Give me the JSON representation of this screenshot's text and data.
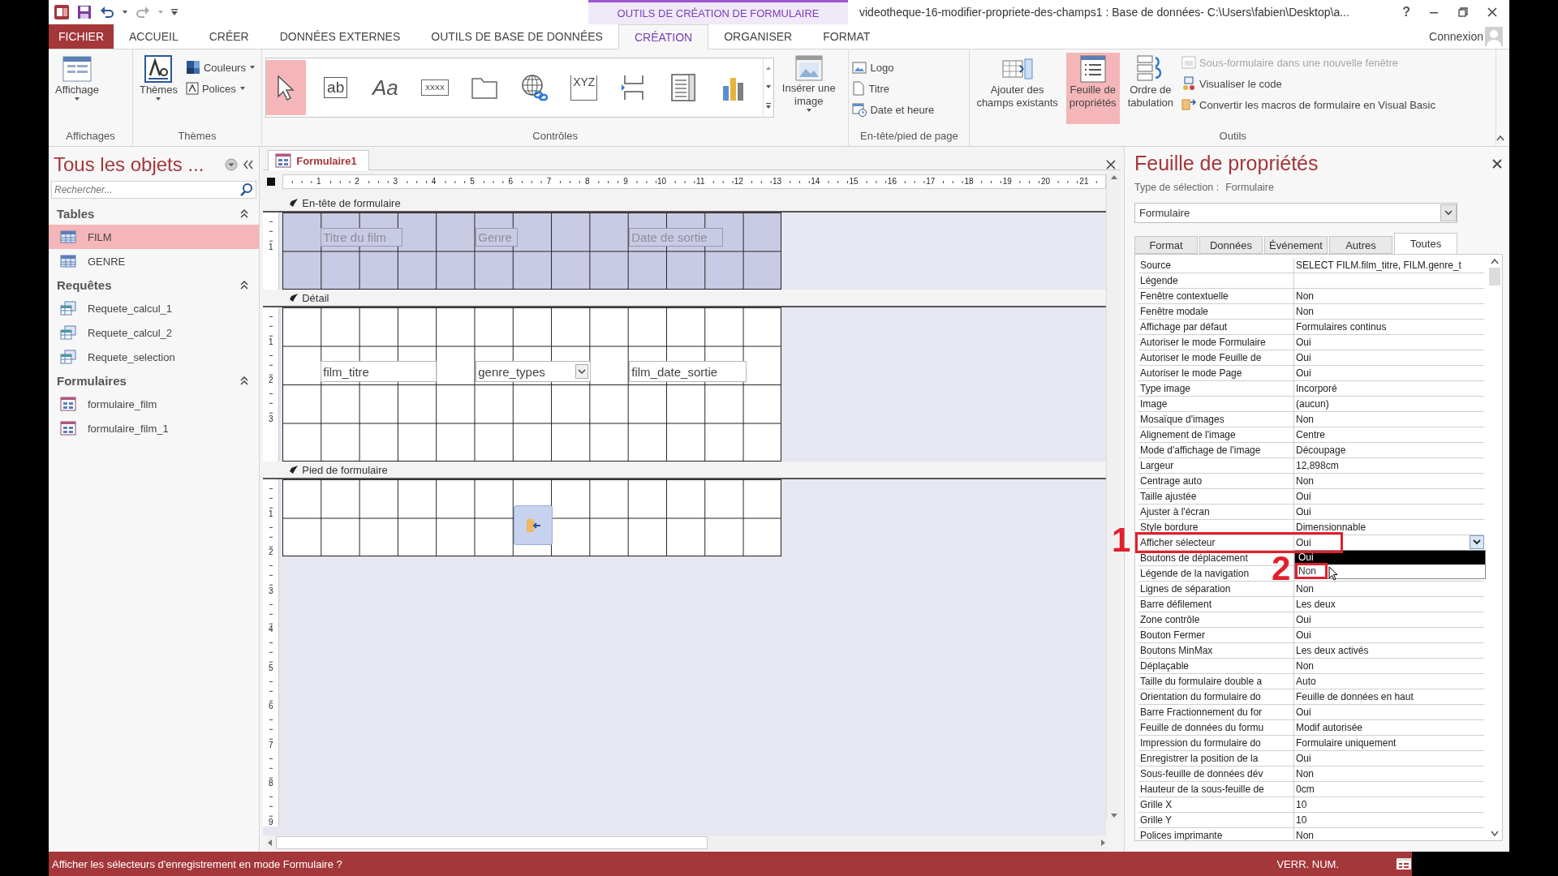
{
  "window": {
    "title": "videotheque-16-modifier-propriete-des-champs1 : Base de données- C:\\Users\\fabien\\Desktop\\a...",
    "contextual_group": "OUTILS DE CRÉATION DE FORMULAIRE",
    "help": "?"
  },
  "ribbon_tabs": [
    {
      "label": "FICHIER",
      "kind": "file",
      "selected": false
    },
    {
      "label": "ACCUEIL",
      "kind": "tab",
      "selected": false
    },
    {
      "label": "CRÉER",
      "kind": "tab",
      "selected": false
    },
    {
      "label": "DONNÉES EXTERNES",
      "kind": "tab",
      "selected": false
    },
    {
      "label": "OUTILS DE BASE DE DONNÉES",
      "kind": "tab",
      "selected": false
    },
    {
      "label": "CRÉATION",
      "kind": "contextual",
      "selected": true
    },
    {
      "label": "ORGANISER",
      "kind": "contextual",
      "selected": false
    },
    {
      "label": "FORMAT",
      "kind": "contextual",
      "selected": false
    }
  ],
  "account": {
    "label": "Connexion"
  },
  "ribbon": {
    "views": {
      "label": "Affichages",
      "button": "Affichage"
    },
    "themes": {
      "label": "Thèmes",
      "button": "Thèmes",
      "colors": "Couleurs",
      "fonts": "Polices"
    },
    "controls": {
      "label": "Contrôles",
      "gallery": [
        {
          "kind": "pointer",
          "selected": true
        },
        {
          "kind": "textbox",
          "glyph": "ab",
          "selected": false
        },
        {
          "kind": "label",
          "glyph": "Aa",
          "selected": false
        },
        {
          "kind": "button",
          "glyph": "XXXX",
          "selected": false
        },
        {
          "kind": "tab",
          "selected": false
        },
        {
          "kind": "hyperlink",
          "selected": false
        },
        {
          "kind": "frame",
          "glyph": "XYZ",
          "selected": false
        },
        {
          "kind": "pagebreak",
          "selected": false
        },
        {
          "kind": "listbox",
          "selected": false
        },
        {
          "kind": "chart",
          "selected": false
        }
      ],
      "insert_image": "Insérer une\nimage"
    },
    "header_footer": {
      "label": "En-tête/pied de page",
      "items": [
        {
          "kind": "logo",
          "label": "Logo"
        },
        {
          "kind": "title",
          "label": "Titre"
        },
        {
          "kind": "datetime",
          "label": "Date et heure"
        }
      ]
    },
    "tools": {
      "label": "Outils",
      "large": [
        {
          "kind": "fields",
          "label": "Ajouter des\nchamps existants",
          "selected": false
        },
        {
          "kind": "sheet",
          "label": "Feuille de\npropriétés",
          "selected": true
        },
        {
          "kind": "taborder",
          "label": "Ordre de\ntabulation",
          "selected": false
        }
      ],
      "small": [
        {
          "kind": "subform",
          "label": "Sous-formulaire dans une nouvelle fenêtre",
          "disabled": true
        },
        {
          "kind": "code",
          "label": "Visualiser le code",
          "disabled": false
        },
        {
          "kind": "convert",
          "label": "Convertir les macros de formulaire en Visual Basic",
          "disabled": false
        }
      ]
    }
  },
  "nav_pane": {
    "title": "Tous les objets ...",
    "search": {
      "placeholder": "Rechercher..."
    },
    "groups": [
      {
        "label": "Tables",
        "expanded": true,
        "items": [
          {
            "label": "FILM",
            "kind": "table",
            "selected": true
          },
          {
            "label": "GENRE",
            "kind": "table",
            "selected": false
          }
        ]
      },
      {
        "label": "Requêtes",
        "expanded": true,
        "items": [
          {
            "label": "Requete_calcul_1",
            "kind": "query",
            "selected": false
          },
          {
            "label": "Requete_calcul_2",
            "kind": "query",
            "selected": false
          },
          {
            "label": "Requete_selection",
            "kind": "query",
            "selected": false
          }
        ]
      },
      {
        "label": "Formulaires",
        "expanded": true,
        "items": [
          {
            "label": "formulaire_film",
            "kind": "form",
            "selected": false
          },
          {
            "label": "formulaire_film_1",
            "kind": "form",
            "selected": false
          }
        ]
      }
    ]
  },
  "document": {
    "tab": "Formulaire1",
    "ruler": [
      "1",
      "2",
      "3",
      "4",
      "5",
      "6",
      "7",
      "8",
      "9",
      "10",
      "11",
      "12",
      "13",
      "14",
      "15",
      "16",
      "17",
      "18",
      "19",
      "20",
      "21"
    ],
    "sections": [
      {
        "title": "En-tête de formulaire",
        "kind": "header",
        "vruler": [
          "1"
        ],
        "controls": [
          {
            "kind": "label",
            "text": "Titre du film"
          },
          {
            "kind": "label",
            "text": "Genre"
          },
          {
            "kind": "label",
            "text": "Date de sortie"
          }
        ]
      },
      {
        "title": "Détail",
        "kind": "detail",
        "vruler": [
          "1",
          "2",
          "3"
        ],
        "controls": [
          {
            "kind": "textbox",
            "text": "film_titre"
          },
          {
            "kind": "combobox",
            "text": "genre_types"
          },
          {
            "kind": "textbox",
            "text": "film_date_sortie"
          }
        ]
      },
      {
        "title": "Pied de formulaire",
        "kind": "footer",
        "vruler": [
          "1",
          "2",
          "3",
          "4",
          "5",
          "6",
          "7",
          "8",
          "9"
        ],
        "controls": [
          {
            "kind": "button"
          }
        ]
      }
    ]
  },
  "property_sheet": {
    "title": "Feuille de propriétés",
    "selection_label": "Type de sélection :",
    "selection_type": "Formulaire",
    "object": "Formulaire",
    "tabs": [
      {
        "label": "Format",
        "selected": false
      },
      {
        "label": "Données",
        "selected": false
      },
      {
        "label": "Événement",
        "selected": false
      },
      {
        "label": "Autres",
        "selected": false
      },
      {
        "label": "Toutes",
        "selected": true
      }
    ],
    "properties": [
      {
        "name": "Source",
        "value": "SELECT FILM.film_titre, FILM.genre_t"
      },
      {
        "name": "Légende"
      },
      {
        "name": "Fenêtre contextuelle",
        "value": "Non"
      },
      {
        "name": "Fenêtre modale",
        "value": "Non"
      },
      {
        "name": "Affichage par défaut",
        "value": "Formulaires continus"
      },
      {
        "name": "Autoriser le mode Formulaire",
        "value": "Oui"
      },
      {
        "name": "Autoriser le mode Feuille de",
        "value": "Oui"
      },
      {
        "name": "Autoriser le mode Page",
        "value": "Oui"
      },
      {
        "name": "Type image",
        "value": "Incorporé"
      },
      {
        "name": "Image",
        "value": "(aucun)"
      },
      {
        "name": "Mosaïque d'images",
        "value": "Non"
      },
      {
        "name": "Alignement de l'image",
        "value": "Centre"
      },
      {
        "name": "Mode d'affichage de l'image",
        "value": "Découpage"
      },
      {
        "name": "Largeur",
        "value": "12,898cm"
      },
      {
        "name": "Centrage auto",
        "value": "Non"
      },
      {
        "name": "Taille ajustée",
        "value": "Oui"
      },
      {
        "name": "Ajuster à l'écran",
        "value": "Oui"
      },
      {
        "name": "Style bordure",
        "value": "Dimensionnable"
      },
      {
        "name": "Afficher sélecteur",
        "value": "Oui",
        "dropdown": [
          {
            "label": "Oui",
            "selected": true
          },
          {
            "label": "Non",
            "selected": false
          }
        ]
      },
      {
        "name": "Boutons de déplacement"
      },
      {
        "name": "Légende de la navigation"
      },
      {
        "name": "Lignes de séparation",
        "value": "Non"
      },
      {
        "name": "Barre défilement",
        "value": "Les deux"
      },
      {
        "name": "Zone contrôle",
        "value": "Oui"
      },
      {
        "name": "Bouton Fermer",
        "value": "Oui"
      },
      {
        "name": "Boutons MinMax",
        "value": "Les deux activés"
      },
      {
        "name": "Déplaçable",
        "value": "Non"
      },
      {
        "name": "Taille du formulaire double a",
        "value": "Auto"
      },
      {
        "name": "Orientation du formulaire do",
        "value": "Feuille de données en haut"
      },
      {
        "name": "Barre Fractionnement du for",
        "value": "Oui"
      },
      {
        "name": "Feuille de données du formu",
        "value": "Modif autorisée"
      },
      {
        "name": "Impression du formulaire do",
        "value": "Formulaire uniquement"
      },
      {
        "name": "Enregistrer la position de la",
        "value": "Oui"
      },
      {
        "name": "Sous-feuille de données dév",
        "value": "Non"
      },
      {
        "name": "Hauteur de la sous-feuille de",
        "value": "0cm"
      },
      {
        "name": "Grille X",
        "value": "10"
      },
      {
        "name": "Grille Y",
        "value": "10"
      },
      {
        "name": "Polices imprimante",
        "value": "Non"
      }
    ]
  },
  "annotations": [
    {
      "label": "1"
    },
    {
      "label": "2"
    }
  ],
  "status_bar": {
    "message": "Afficher les sélecteurs d'enregistrement en mode Formulaire ?",
    "indicator": "VERR. NUM."
  }
}
